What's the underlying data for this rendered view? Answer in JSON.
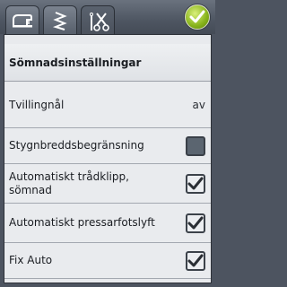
{
  "tabs": [
    {
      "icon": "sewing-machine-icon",
      "active": false
    },
    {
      "icon": "stitch-zigzag-icon",
      "active": false
    },
    {
      "icon": "needle-scissors-icon",
      "active": true
    }
  ],
  "ok_button": {
    "icon": "checkmark-icon"
  },
  "panel": {
    "title": "Sömnadsinställningar",
    "rows": [
      {
        "label": "Tvillingnål",
        "type": "value",
        "value": "av"
      },
      {
        "label": "Stygnbreddsbegränsning",
        "type": "checkbox",
        "checked": false
      },
      {
        "label": "Automatiskt trådklipp, sömnad",
        "type": "checkbox",
        "checked": true
      },
      {
        "label": "Automatiskt pressarfotslyft",
        "type": "checkbox",
        "checked": true
      },
      {
        "label": "Fix Auto",
        "type": "checkbox",
        "checked": true
      }
    ]
  },
  "colors": {
    "accent": "#8ab81f",
    "panel_bg": "#e8eaed",
    "frame": "#4d5460"
  }
}
